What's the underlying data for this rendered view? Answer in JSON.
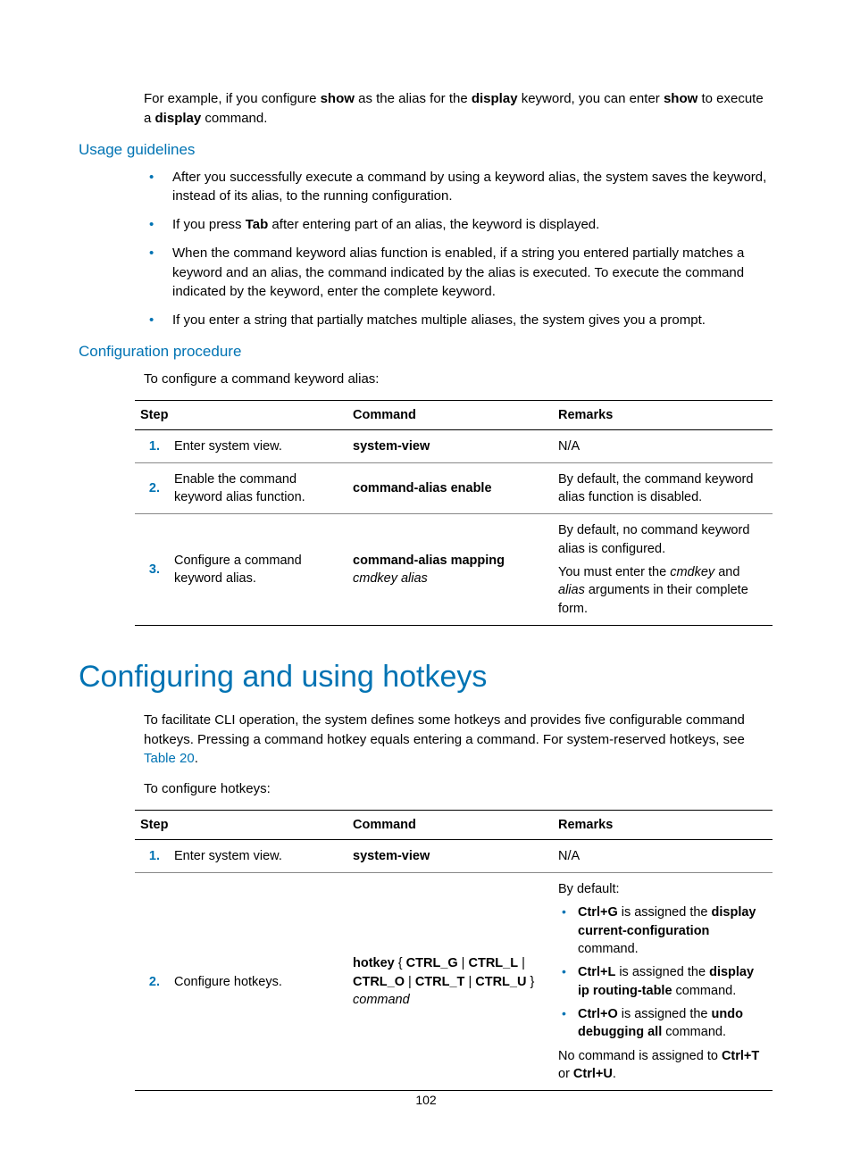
{
  "intro_para": {
    "pre": "For example, if you configure ",
    "b1": "show",
    "mid1": " as the alias for the ",
    "b2": "display",
    "mid2": " keyword, you can enter ",
    "b3": "show",
    "mid3": " to execute a ",
    "b4": "display",
    "post": " command."
  },
  "usage_heading": "Usage guidelines",
  "usage_bullets": {
    "b1": "After you successfully execute a command by using a keyword alias, the system saves the keyword, instead of its alias, to the running configuration.",
    "b2_pre": "If you press ",
    "b2_bold": "Tab",
    "b2_post": " after entering part of an alias, the keyword is displayed.",
    "b3": "When the command keyword alias function is enabled, if a string you entered partially matches a keyword and an alias, the command indicated by the alias is executed. To execute the command indicated by the keyword, enter the complete keyword.",
    "b4": "If you enter a string that partially matches multiple aliases, the system gives you a prompt."
  },
  "config_heading": "Configuration procedure",
  "config_intro": "To configure a command keyword alias:",
  "table_headers": {
    "step": "Step",
    "cmd": "Command",
    "rem": "Remarks"
  },
  "table1": {
    "r1_num": "1.",
    "r1_step": "Enter system view.",
    "r1_cmd": "system-view",
    "r1_rem": "N/A",
    "r2_num": "2.",
    "r2_step": "Enable the command keyword alias function.",
    "r2_cmd": "command-alias enable",
    "r2_rem": "By default, the command keyword alias function is disabled.",
    "r3_num": "3.",
    "r3_step": "Configure a command keyword alias.",
    "r3_cmd_b": "command-alias mapping",
    "r3_cmd_i": " cmdkey alias",
    "r3_rem_p1": "By default, no command keyword alias is configured.",
    "r3_rem_p2_pre": "You must enter the ",
    "r3_rem_p2_i1": "cmdkey",
    "r3_rem_p2_mid": " and ",
    "r3_rem_p2_i2": "alias",
    "r3_rem_p2_post": " arguments in their complete form."
  },
  "major_heading": "Configuring and using hotkeys",
  "hotkeys_intro": {
    "pre": "To facilitate CLI operation, the system defines some hotkeys and provides five configurable command hotkeys. Pressing a command hotkey equals entering a command. For system-reserved hotkeys, see ",
    "link": "Table 20",
    "post": "."
  },
  "hotkeys_config_intro": "To configure hotkeys:",
  "table2": {
    "r1_num": "1.",
    "r1_step": "Enter system view.",
    "r1_cmd": "system-view",
    "r1_rem": "N/A",
    "r2_num": "2.",
    "r2_step": "Configure hotkeys.",
    "r2_cmd_b": "hotkey",
    "r2_cmd_mid1": " { ",
    "r2_cmd_b2": "CTRL_G",
    "r2_cmd_mid2": " | ",
    "r2_cmd_b3": "CTRL_L",
    "r2_cmd_mid3": " | ",
    "r2_cmd_b4": "CTRL_O",
    "r2_cmd_mid4": " | ",
    "r2_cmd_b5": "CTRL_T",
    "r2_cmd_mid5": " | ",
    "r2_cmd_b6": "CTRL_U",
    "r2_cmd_mid6": " } ",
    "r2_cmd_i": "command",
    "r2_rem_default": "By default:",
    "r2_rem_li1_b1": "Ctrl+G",
    "r2_rem_li1_mid": " is assigned the ",
    "r2_rem_li1_b2": "display current-configuration",
    "r2_rem_li1_post": " command.",
    "r2_rem_li2_b1": "Ctrl+L",
    "r2_rem_li2_mid": " is assigned the ",
    "r2_rem_li2_b2": "display ip routing-table",
    "r2_rem_li2_post": " command.",
    "r2_rem_li3_b1": "Ctrl+O",
    "r2_rem_li3_mid": " is assigned the ",
    "r2_rem_li3_b2": "undo debugging all",
    "r2_rem_li3_post": " command.",
    "r2_rem_p2_pre": "No command is assigned to ",
    "r2_rem_p2_b1": "Ctrl+T",
    "r2_rem_p2_mid": " or ",
    "r2_rem_p2_b2": "Ctrl+U",
    "r2_rem_p2_post": "."
  },
  "page_number": "102"
}
